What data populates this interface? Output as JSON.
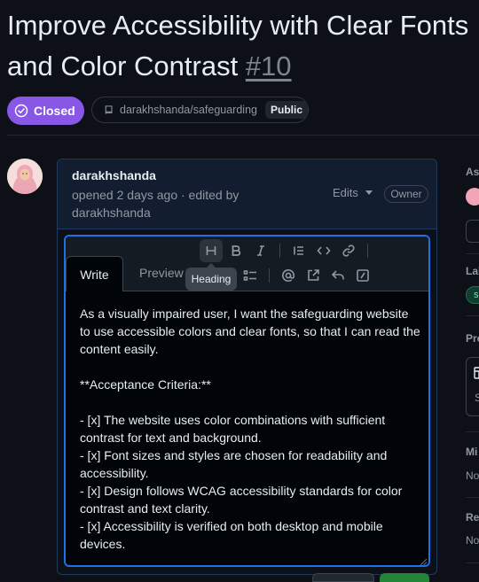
{
  "issue": {
    "title_line1": "Improve Accessibility with Clear Fonts",
    "title_line2": "and Color Contrast",
    "number": "#10",
    "status": "Closed",
    "repo": "darakhshanda/safeguarding",
    "visibility": "Public"
  },
  "comment": {
    "author": "darakhshanda",
    "meta_line1": "opened 2 days ago · edited by",
    "meta_line2": "darakhshanda",
    "edits_label": "Edits",
    "role_badge": "Owner"
  },
  "editor": {
    "tab_write": "Write",
    "tab_preview": "Preview",
    "tooltip": "Heading",
    "toolbar_icons": [
      "heading-icon",
      "bold-icon",
      "italic-icon",
      "quote-icon",
      "code-icon",
      "link-icon",
      "numbered-list-icon",
      "task-list-icon",
      "mention-icon",
      "cross-reference-icon",
      "reply-icon",
      "slash-command-icon"
    ],
    "body": "As a visually impaired user, I want the safeguarding website to use accessible colors and clear fonts, so that I can read the content easily.\n\n**Acceptance Criteria:**\n\n- [x] The website uses color combinations with sufficient contrast for text and background.\n- [x] Font sizes and styles are chosen for readability and accessibility.\n- [x] Design follows WCAG accessibility standards for color contrast and text clarity.\n- [x] Accessibility is verified on both desktop and mobile devices."
  },
  "sidebar": {
    "assignees": "Ass",
    "labels": "Lab",
    "label_chip": "s",
    "projects": "Pro",
    "project_status": "S",
    "milestone": "Mi",
    "milestone_value": "No",
    "relationships": "Rel",
    "relationships_value": "No"
  },
  "colors": {
    "background": "#0d1117",
    "closed_badge": "#8957e5",
    "editor_focus": "#1f6feb",
    "header_bg": "#121d2f"
  }
}
